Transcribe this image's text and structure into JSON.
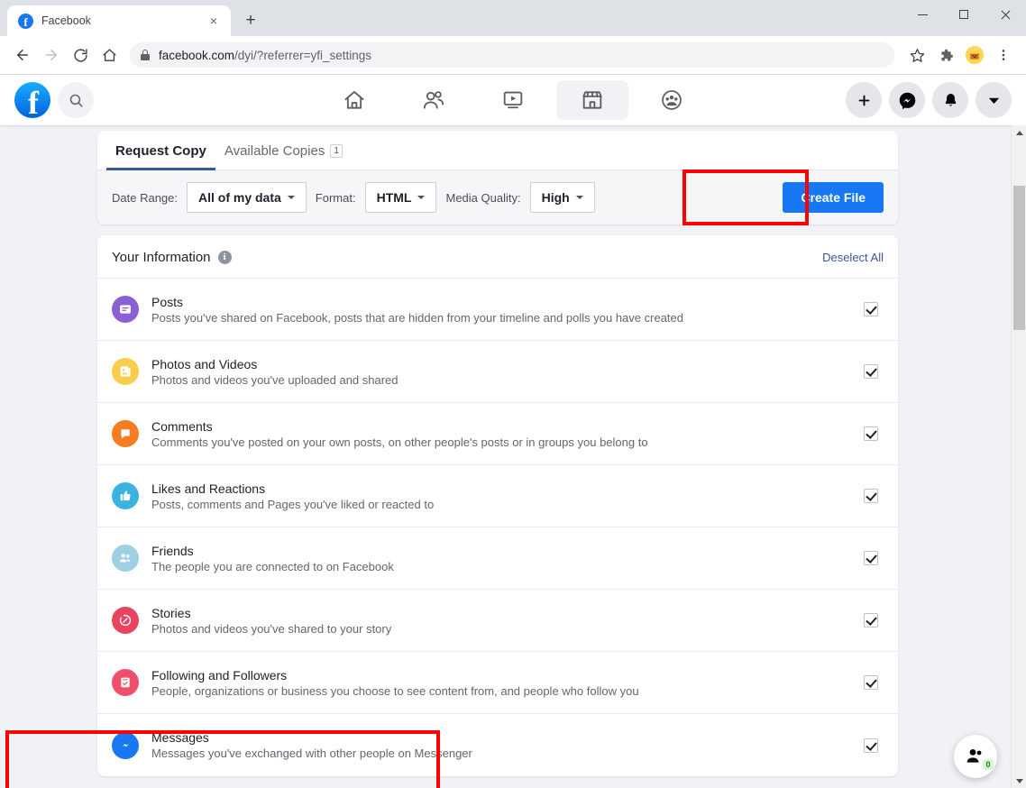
{
  "browser": {
    "tab": {
      "title": "Facebook",
      "favicon": "facebook-favicon",
      "close": "×"
    },
    "newtab_label": "+",
    "window_controls": {
      "minimize": "minimize-icon",
      "maximize": "maximize-icon",
      "close": "close-icon"
    },
    "nav": {
      "back": "←",
      "forward": "→",
      "reload": "reload-icon",
      "home": "home-icon"
    },
    "omnibox": {
      "url_main": "facebook.com",
      "url_path": "/dyi/?referrer=yfi_settings",
      "full_url": "facebook.com/dyi/?referrer=yfi_settings",
      "lock": "lock-icon"
    },
    "toolbar_right": {
      "bookmark": "star-icon",
      "extensions": "puzzle-icon",
      "profile": "dog-avatar-icon",
      "menu": "three-dot-menu-icon"
    }
  },
  "fb_header": {
    "logo": "facebook-logo",
    "logo_letter": "f",
    "search": "search-icon",
    "center_nav": [
      {
        "name": "home",
        "icon": "home-icon",
        "active": false
      },
      {
        "name": "friends",
        "icon": "friends-icon",
        "active": false
      },
      {
        "name": "watch",
        "icon": "watch-icon",
        "active": false
      },
      {
        "name": "marketplace",
        "icon": "marketplace-icon",
        "active": true
      },
      {
        "name": "groups",
        "icon": "groups-icon",
        "active": false
      }
    ],
    "right_nav": [
      {
        "name": "create",
        "icon": "plus-icon"
      },
      {
        "name": "messenger",
        "icon": "messenger-icon"
      },
      {
        "name": "notifications",
        "icon": "bell-icon"
      },
      {
        "name": "account",
        "icon": "chevron-down-icon"
      }
    ]
  },
  "tabs": [
    {
      "label": "Request Copy",
      "active": true,
      "badge": null
    },
    {
      "label": "Available Copies",
      "active": false,
      "badge": "1"
    }
  ],
  "filters": {
    "date_range_label": "Date Range:",
    "date_range_value": "All of my data",
    "format_label": "Format:",
    "format_value": "HTML",
    "media_quality_label": "Media Quality:",
    "media_quality_value": "High",
    "create_file_label": "Create File"
  },
  "your_information": {
    "title": "Your Information",
    "info_icon": "info-icon",
    "info_glyph": "i",
    "deselect_all": "Deselect All"
  },
  "items": [
    {
      "title": "Posts",
      "desc": "Posts you've shared on Facebook, posts that are hidden from your timeline and polls you have created",
      "icon": "posts-icon",
      "color": "#8b5fd6",
      "checked": true,
      "highlighted": false
    },
    {
      "title": "Photos and Videos",
      "desc": "Photos and videos you've uploaded and shared",
      "icon": "photos-videos-icon",
      "color": "#f7cd49",
      "checked": true,
      "highlighted": false
    },
    {
      "title": "Comments",
      "desc": "Comments you've posted on your own posts, on other people's posts or in groups you belong to",
      "icon": "comments-icon",
      "color": "#f57c20",
      "checked": true,
      "highlighted": false
    },
    {
      "title": "Likes and Reactions",
      "desc": "Posts, comments and Pages you've liked or reacted to",
      "icon": "likes-reactions-icon",
      "color": "#3bb3e0",
      "checked": true,
      "highlighted": false
    },
    {
      "title": "Friends",
      "desc": "The people you are connected to on Facebook",
      "icon": "friends-icon",
      "color": "#9fcfe3",
      "checked": true,
      "highlighted": false
    },
    {
      "title": "Stories",
      "desc": "Photos and videos you've shared to your story",
      "icon": "stories-icon",
      "color": "#e8445f",
      "checked": true,
      "highlighted": false
    },
    {
      "title": "Following and Followers",
      "desc": "People, organizations or business you choose to see content from, and people who follow you",
      "icon": "following-followers-icon",
      "color": "#ef4f68",
      "checked": true,
      "highlighted": false
    },
    {
      "title": "Messages",
      "desc": "Messages you've exchanged with other people on Messenger",
      "icon": "messages-icon",
      "color": "#1878f3",
      "checked": true,
      "highlighted": true
    }
  ],
  "chat_fab": {
    "icon": "contacts-icon",
    "badge": "0"
  },
  "annotations": {
    "color": "#ff0000",
    "boxes": [
      "create-file-button",
      "messages-row"
    ]
  },
  "scrollbar": {
    "up": "scroll-up-arrow",
    "down": "scroll-down-arrow",
    "thumb": "scroll-thumb"
  }
}
